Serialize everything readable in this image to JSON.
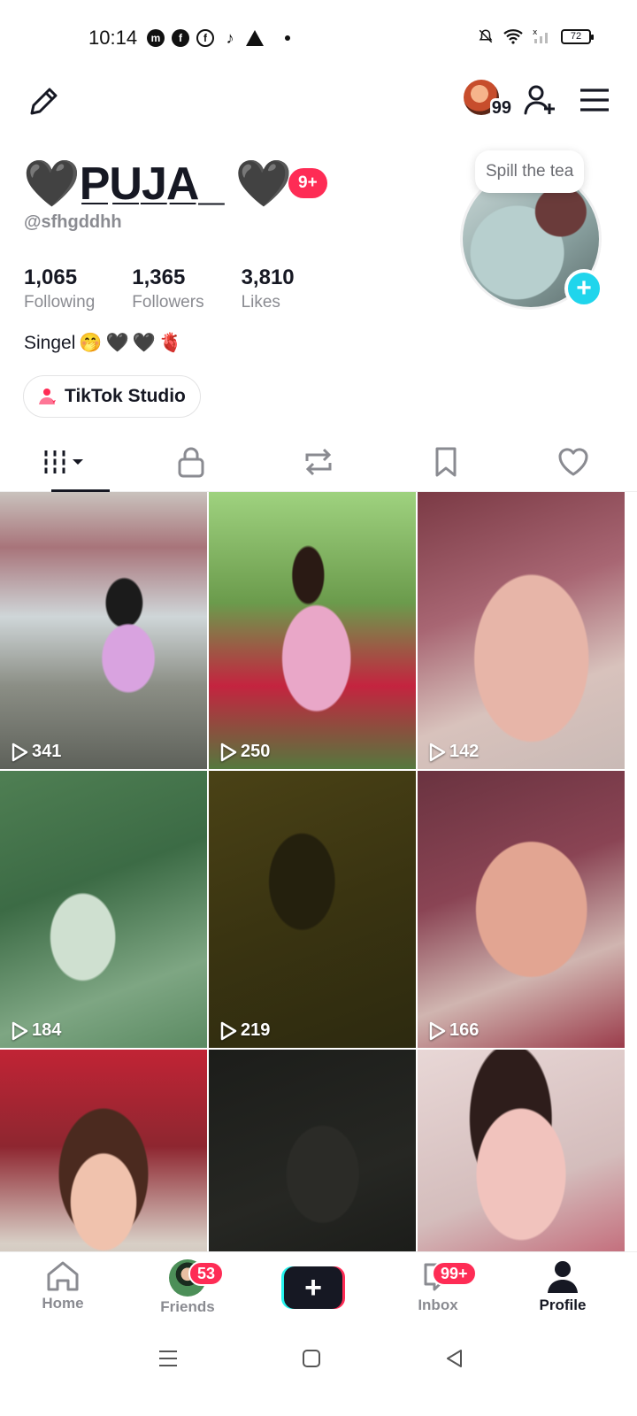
{
  "status_bar": {
    "time": "10:14",
    "left_icons": [
      "messenger-icon",
      "facebook-icon",
      "facebook-icon",
      "tiktok-icon",
      "warning-icon",
      "dot-icon"
    ],
    "right_icons": [
      "mute-icon",
      "wifi-icon",
      "signal-icon"
    ],
    "battery": "72"
  },
  "header": {
    "visitors_count": "99",
    "icons": [
      "edit-icon",
      "add-friend-icon",
      "menu-icon"
    ]
  },
  "profile": {
    "display_name": "🖤P̲U̲J̲A̲_ 🖤",
    "notification_badge": "9+",
    "username": "@sfhgddhh",
    "stats": [
      {
        "value": "1,065",
        "label": "Following"
      },
      {
        "value": "1,365",
        "label": "Followers"
      },
      {
        "value": "3,810",
        "label": "Likes"
      }
    ],
    "bio": "Singel",
    "bio_emoji": [
      "🤭",
      "🖤",
      "🖤",
      "🫀"
    ],
    "studio_label": "TikTok Studio",
    "avatar_tooltip": "Spill the tea",
    "avatar_add": "+"
  },
  "tabs": [
    "videos-grid-icon",
    "lock-icon",
    "repost-icon",
    "bookmark-icon",
    "heart-icon"
  ],
  "videos": [
    {
      "views": "341"
    },
    {
      "views": "250"
    },
    {
      "views": "142"
    },
    {
      "views": "184"
    },
    {
      "views": "219"
    },
    {
      "views": "166"
    },
    {
      "views": ""
    },
    {
      "views": ""
    },
    {
      "views": ""
    }
  ],
  "bottom_nav": {
    "home": "Home",
    "friends": "Friends",
    "friends_badge": "53",
    "create": "+",
    "inbox": "Inbox",
    "inbox_badge": "99+",
    "profile": "Profile"
  },
  "colors": {
    "accent_red": "#fe2c55",
    "accent_cyan": "#20d5ec",
    "text_primary": "#161823",
    "text_secondary": "#8a8b91"
  }
}
